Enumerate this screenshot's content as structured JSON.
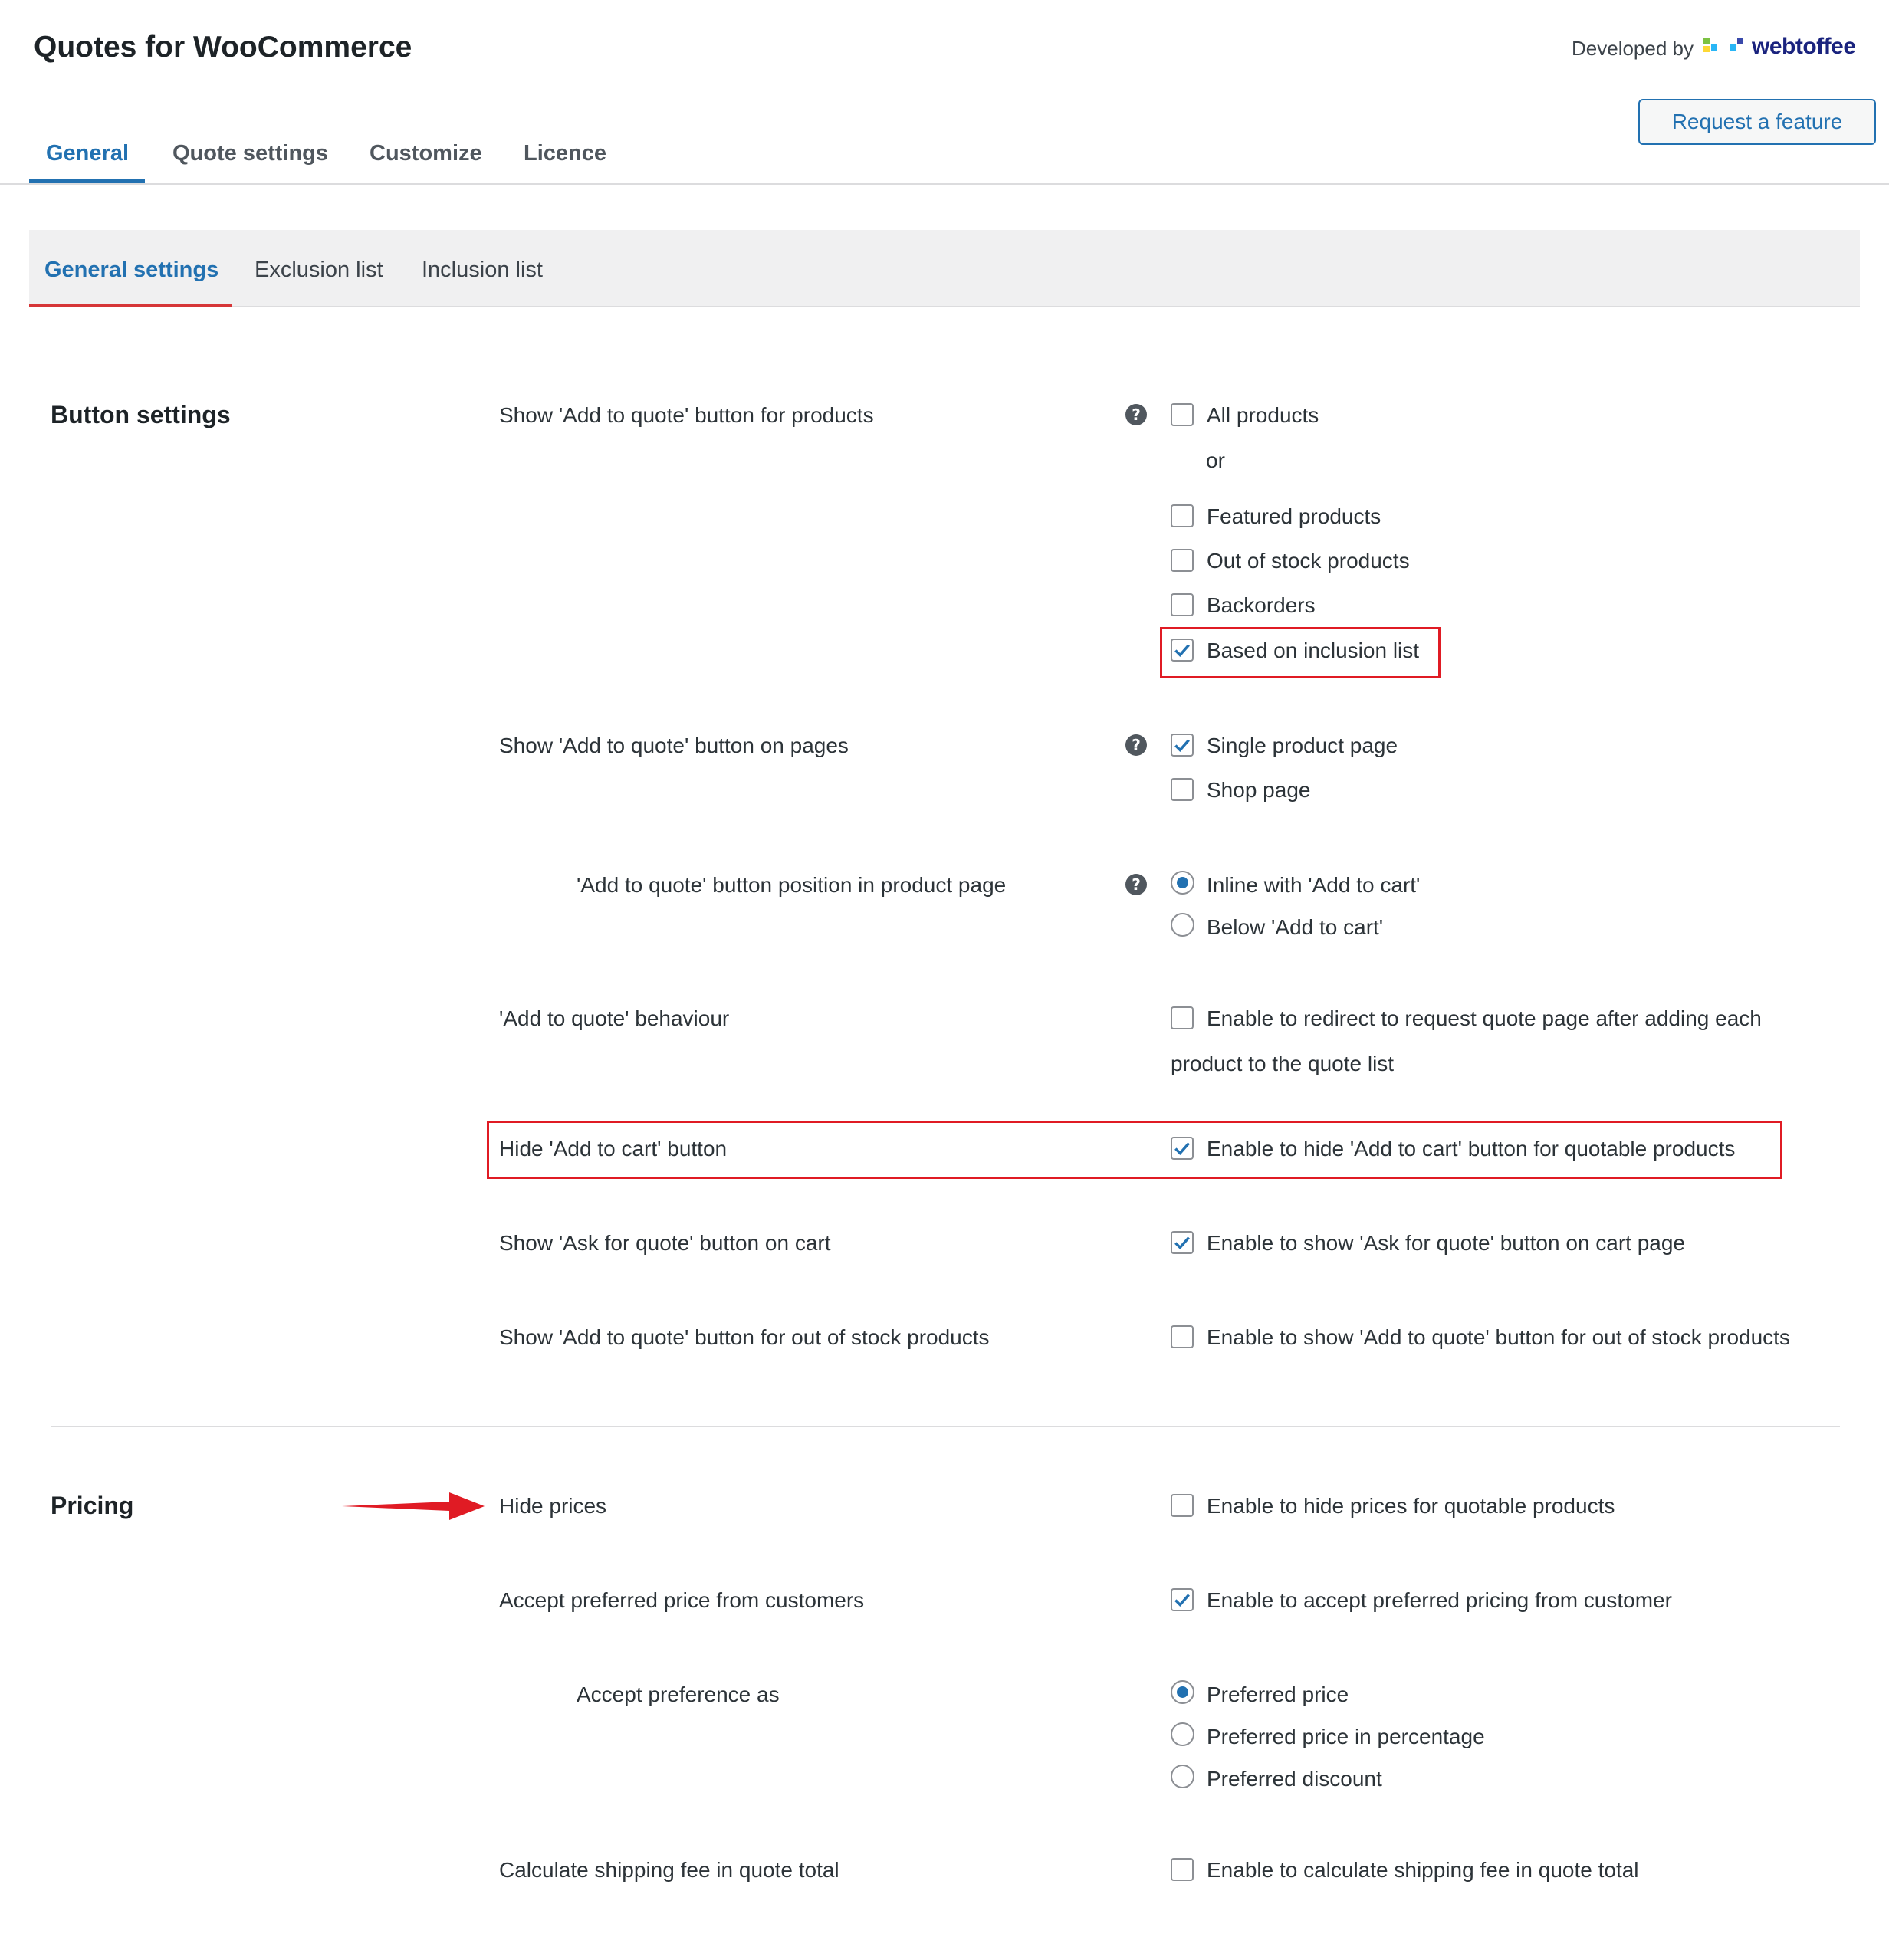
{
  "header": {
    "title": "Quotes for WooCommerce",
    "developed_by": "Developed by",
    "brand": "webtoffee",
    "request_feature": "Request a feature"
  },
  "tabs": [
    "General",
    "Quote settings",
    "Customize",
    "Licence"
  ],
  "subtabs": [
    "General settings",
    "Exclusion list",
    "Inclusion list"
  ],
  "colors": {
    "accent": "#2271b1",
    "highlight": "#e01b24"
  },
  "button_settings": {
    "title": "Button settings",
    "products": {
      "label": "Show 'Add to quote' button for products",
      "all_products": {
        "label": "All products",
        "checked": false
      },
      "or": "or",
      "featured": {
        "label": "Featured products",
        "checked": false
      },
      "out_of_stock": {
        "label": "Out of stock products",
        "checked": false
      },
      "backorders": {
        "label": "Backorders",
        "checked": false
      },
      "inclusion": {
        "label": "Based on inclusion list",
        "checked": true
      }
    },
    "pages": {
      "label": "Show 'Add to quote' button on pages",
      "single": {
        "label": "Single product page",
        "checked": true
      },
      "shop": {
        "label": "Shop page",
        "checked": false
      }
    },
    "position": {
      "label": "'Add to quote' button position in product page",
      "inline": {
        "label": "Inline with 'Add to cart'",
        "selected": true
      },
      "below": {
        "label": "Below 'Add to cart'",
        "selected": false
      }
    },
    "behaviour": {
      "label": "'Add to quote' behaviour",
      "line1": "Enable to redirect to request quote page after adding each",
      "line2": "product to the quote list",
      "checked": false
    },
    "hide_cart": {
      "label": "Hide 'Add to cart' button",
      "option": "Enable to hide 'Add to cart' button for quotable products",
      "checked": true
    },
    "ask_quote": {
      "label": "Show 'Ask for quote' button on cart",
      "option": "Enable to show 'Ask for quote' button on cart page",
      "checked": true
    },
    "out_of_stock_btn": {
      "label": "Show 'Add to quote' button for out of stock products",
      "option": "Enable to show 'Add to quote' button for out of stock products",
      "checked": false
    }
  },
  "pricing": {
    "title": "Pricing",
    "hide_prices": {
      "label": "Hide prices",
      "option": "Enable to hide prices for quotable products",
      "checked": false
    },
    "preferred_price": {
      "label": "Accept preferred price from customers",
      "option": "Enable to accept preferred pricing from customer",
      "checked": true
    },
    "preference_as": {
      "label": "Accept preference as",
      "price": {
        "label": "Preferred price",
        "selected": true
      },
      "percentage": {
        "label": "Preferred price in percentage",
        "selected": false
      },
      "discount": {
        "label": "Preferred discount",
        "selected": false
      }
    },
    "shipping": {
      "label": "Calculate shipping fee in quote total",
      "option": "Enable to calculate shipping fee in quote total",
      "checked": false
    }
  }
}
